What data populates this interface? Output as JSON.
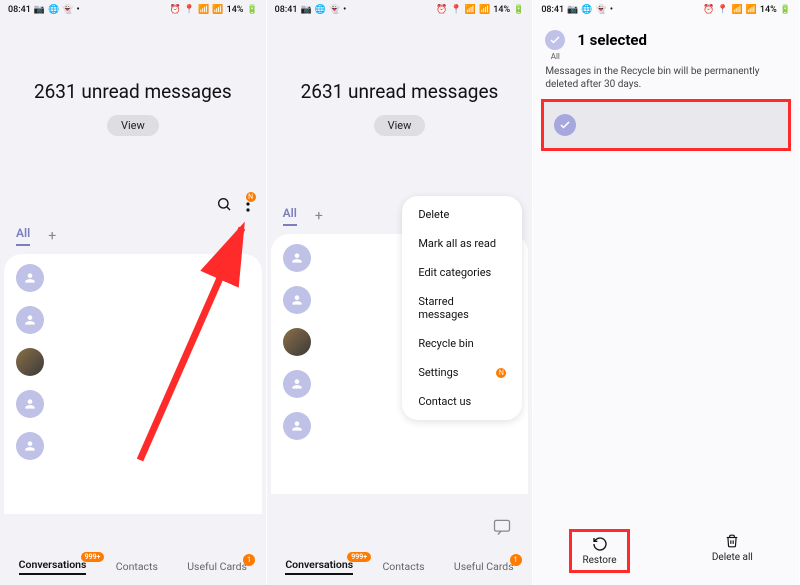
{
  "status": {
    "time": "08:41",
    "battery": "14%"
  },
  "header": {
    "title": "2631 unread messages",
    "view": "View"
  },
  "tabs": {
    "all": "All"
  },
  "nav": {
    "conversations": "Conversations",
    "contacts": "Contacts",
    "useful": "Useful Cards",
    "badge1": "999+",
    "badge2": "1"
  },
  "menu": {
    "delete": "Delete",
    "markRead": "Mark all as read",
    "editCat": "Edit categories",
    "starred": "Starred messages",
    "recycle": "Recycle bin",
    "settings": "Settings",
    "contact": "Contact us",
    "n": "N"
  },
  "p3": {
    "selected": "1 selected",
    "all": "All",
    "note": "Messages in the Recycle bin will be permanently deleted after 30 days.",
    "restore": "Restore",
    "deleteAll": "Delete all"
  }
}
